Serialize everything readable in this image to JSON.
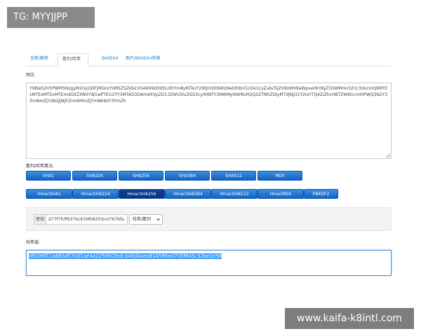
{
  "watermarks": {
    "top": "TG: MYYJJPP",
    "bottom": "www.kaifa-k8intl.com"
  },
  "tabs": [
    {
      "label": "加密/解密",
      "active": false
    },
    {
      "label": "散列/哈希",
      "active": true
    },
    {
      "label": "BASE64",
      "active": false
    },
    {
      "label": "图片/BASE64转换",
      "active": false
    }
  ],
  "plaintext": {
    "label": "明文:",
    "value": "YXBwS2V5PWM5NzgyM2UyODFjMDcxYzM5ZSZkb21haW49d3d3LnlhYm8yNTkuY29tJm5hbWU9eGlhbnl1cGx1cyZub25jZV9zdHI9aWpveHk0bjZ3OWMmcGFzc3dvcmQ9MTExMTExMTExMTEmdGltZXN0YW1wPTE1OTY3MTA5ODAmdXVpZD13ZWV2luZGS3cy00NTY3MWMyNWMzM2Q5ZTNhZDIyMTdjNjQ1Y2IxYTQ4ZiZhcHBTZWN1cml0PWQ3N2Y3ZmNmZjYzN2JjNjFiZmI4MmZjYmNkNzY3YmZh"
  },
  "algorithms": {
    "label": "散列/哈希算法:",
    "row1": [
      "SHA1",
      "SHA224",
      "SHA256",
      "SHA384",
      "SHA512",
      "MD5"
    ],
    "row2": [
      "HmacSHA1",
      "HmacSHA224",
      "HmacSHA256",
      "HmacSHA384",
      "HmacSHA512",
      "HmacMD5",
      "PBKDF2"
    ],
    "active": "HmacSHA256"
  },
  "key": {
    "addon": "密钥",
    "value": "d77f7fcff637bc61bfb82fcbcd767bfa",
    "dropdown_label": "哈希/散列"
  },
  "result": {
    "label": "哈希值:",
    "value": "d9106f11a865d57e31ae4a2250fc2bdc34bd4aea814585e0705f645c32be2e56"
  },
  "colors": {
    "button": "#1a6fd1",
    "active_button": "#0e3f95",
    "link": "#2a86c8"
  }
}
